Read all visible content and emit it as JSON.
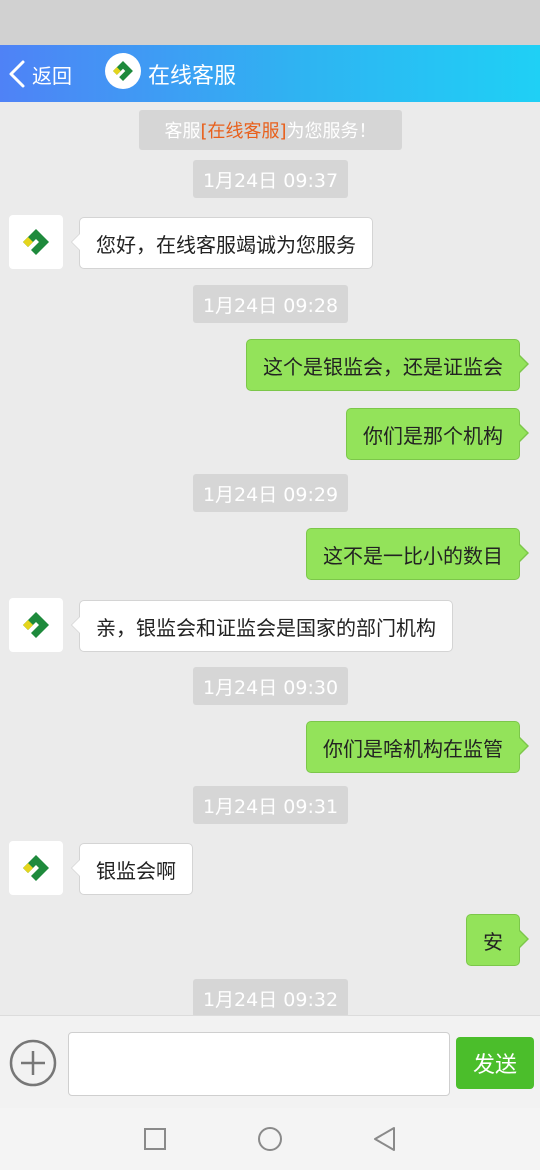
{
  "header": {
    "back_label": "返回",
    "title": "在线客服"
  },
  "notice": {
    "prefix": "客服",
    "highlight": "[在线客服]",
    "suffix": "为您服务！"
  },
  "messages": [
    {
      "type": "timestamp",
      "text": "1月24日 09:37"
    },
    {
      "type": "in",
      "text": "您好，在线客服竭诚为您服务"
    },
    {
      "type": "timestamp",
      "text": "1月24日 09:28"
    },
    {
      "type": "out",
      "text": "这个是银监会，还是证监会"
    },
    {
      "type": "out",
      "text": "你们是那个机构"
    },
    {
      "type": "timestamp",
      "text": "1月24日 09:29"
    },
    {
      "type": "out",
      "text": "这不是一比小的数目"
    },
    {
      "type": "in",
      "text": "亲，银监会和证监会是国家的部门机构"
    },
    {
      "type": "timestamp",
      "text": "1月24日 09:30"
    },
    {
      "type": "out",
      "text": "你们是啥机构在监管"
    },
    {
      "type": "timestamp",
      "text": "1月24日 09:31"
    },
    {
      "type": "in",
      "text": "银监会啊"
    },
    {
      "type": "out",
      "text": "安"
    },
    {
      "type": "timestamp",
      "text": "1月24日 09:32"
    }
  ],
  "composer": {
    "input_value": "",
    "send_label": "发送"
  },
  "colors": {
    "header_start": "#4f82f6",
    "header_end": "#1fd0f5",
    "outgoing_bubble": "#93e35a",
    "send_button": "#4bbe2b",
    "notice_highlight": "#e8601c",
    "logo_green": "#1e8a3c",
    "logo_yellow": "#e5d51c"
  },
  "icons": {
    "back": "chevron-left-icon",
    "avatar": "company-logo-icon",
    "plus": "plus-circle-icon",
    "nav_recent": "square-icon",
    "nav_home": "circle-icon",
    "nav_back": "triangle-back-icon"
  }
}
